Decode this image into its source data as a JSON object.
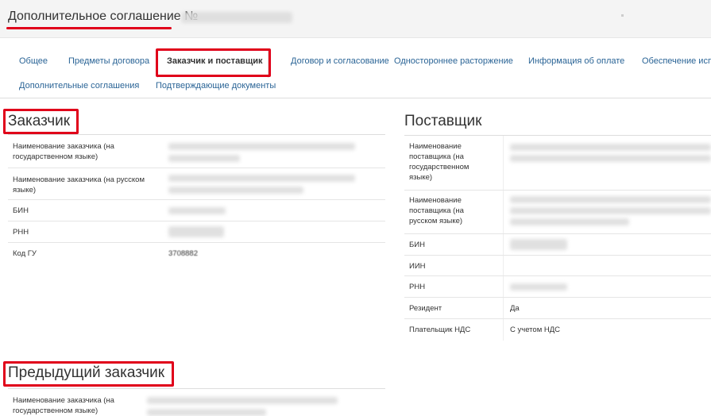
{
  "header": {
    "title": "Дополнительное соглашение №"
  },
  "tabs": [
    {
      "label": "Общее",
      "active": false
    },
    {
      "label": "Предметы договора",
      "active": false
    },
    {
      "label": "Заказчик и поставщик",
      "active": true
    },
    {
      "label": "Договор и согласование",
      "active": false
    },
    {
      "label": "Одностороннее расторжение",
      "active": false
    },
    {
      "label": "Информация об оплате",
      "active": false
    },
    {
      "label": "Обеспечение испо",
      "active": false
    },
    {
      "label": "Дополнительные соглашения",
      "active": false
    },
    {
      "label": "Подтверждающие документы",
      "active": false
    }
  ],
  "customer": {
    "title": "Заказчик",
    "rows": [
      {
        "label": "Наименование заказчика (на государственном языке)"
      },
      {
        "label": "Наименование заказчика (на русском языке)"
      },
      {
        "label": "БИН"
      },
      {
        "label": "РНН"
      },
      {
        "label": "Код ГУ",
        "value": "3708882"
      }
    ]
  },
  "supplier": {
    "title": "Поставщик",
    "rows": [
      {
        "label": "Наименование поставщика (на государственном языке)"
      },
      {
        "label": "Наименование поставщика (на русском языке)"
      },
      {
        "label": "БИН"
      },
      {
        "label": "ИИН"
      },
      {
        "label": "РНН"
      },
      {
        "label": "Резидент",
        "value": "Да"
      },
      {
        "label": "Плательщик НДС",
        "value": "С учетом НДС"
      }
    ]
  },
  "previous_customer": {
    "title": "Предыдущий заказчик",
    "rows": [
      {
        "label": "Наименование заказчика (на государственном языке)"
      }
    ]
  },
  "colors": {
    "annotation": "#e0001a",
    "link": "#2a6496",
    "header_bg": "#f4f4f4"
  }
}
